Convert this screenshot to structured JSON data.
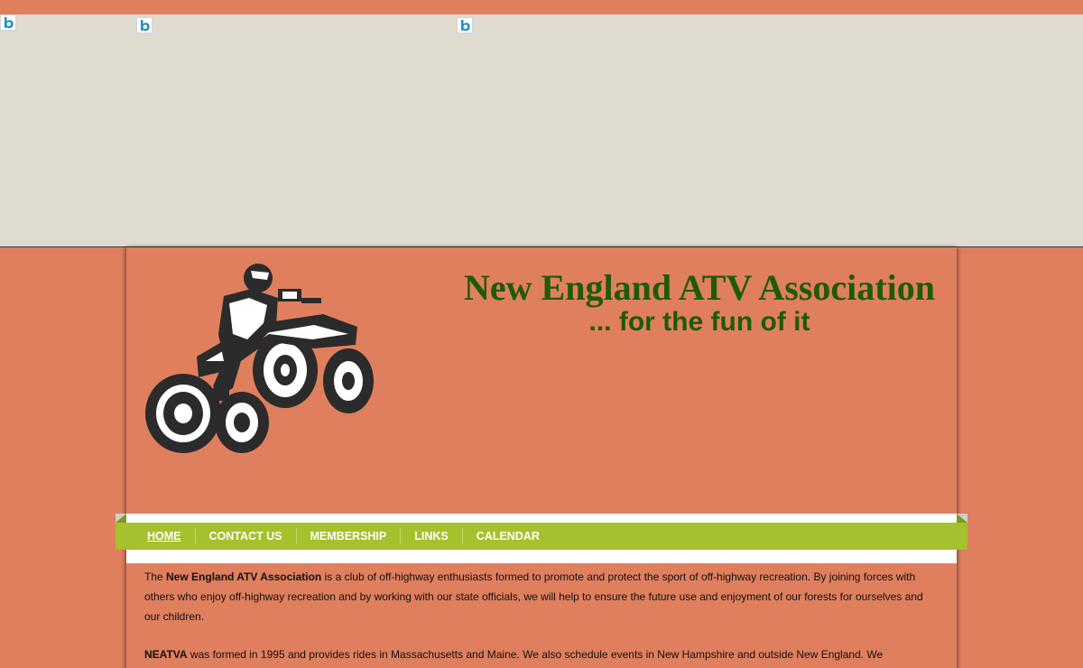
{
  "header": {
    "title": "New England ATV Association",
    "tagline": "... for the fun of it"
  },
  "nav": {
    "items": [
      {
        "label": "HOME",
        "active": true
      },
      {
        "label": "CONTACT US",
        "active": false
      },
      {
        "label": "MEMBERSHIP",
        "active": false
      },
      {
        "label": "LINKS",
        "active": false
      },
      {
        "label": "CALENDAR",
        "active": false
      }
    ]
  },
  "content": {
    "p1_prefix": "The ",
    "p1_bold": "New England ATV Association",
    "p1_rest": " is a club of off-highway enthusiasts formed to promote and protect the sport of off-highway recreation. By joining forces with others who enjoy off-highway recreation and by working with our state officials, we will help to ensure the future use and enjoyment of our forests for ourselves and our children.",
    "p2_bold": "NEATVA",
    "p2_rest": " was formed in 1995 and provides rides in Massachusetts and Maine. We also schedule events in New Hampshire and outside New England. We"
  },
  "icons": {
    "broken_image": "bing-b-icon",
    "logo": "atv-rider-icon"
  },
  "colors": {
    "background": "#e07f5e",
    "banner": "#dfdbd0",
    "title_green": "#1e5a0c",
    "nav_green": "#a5c12d",
    "icon_blue": "#1e8fc8"
  }
}
